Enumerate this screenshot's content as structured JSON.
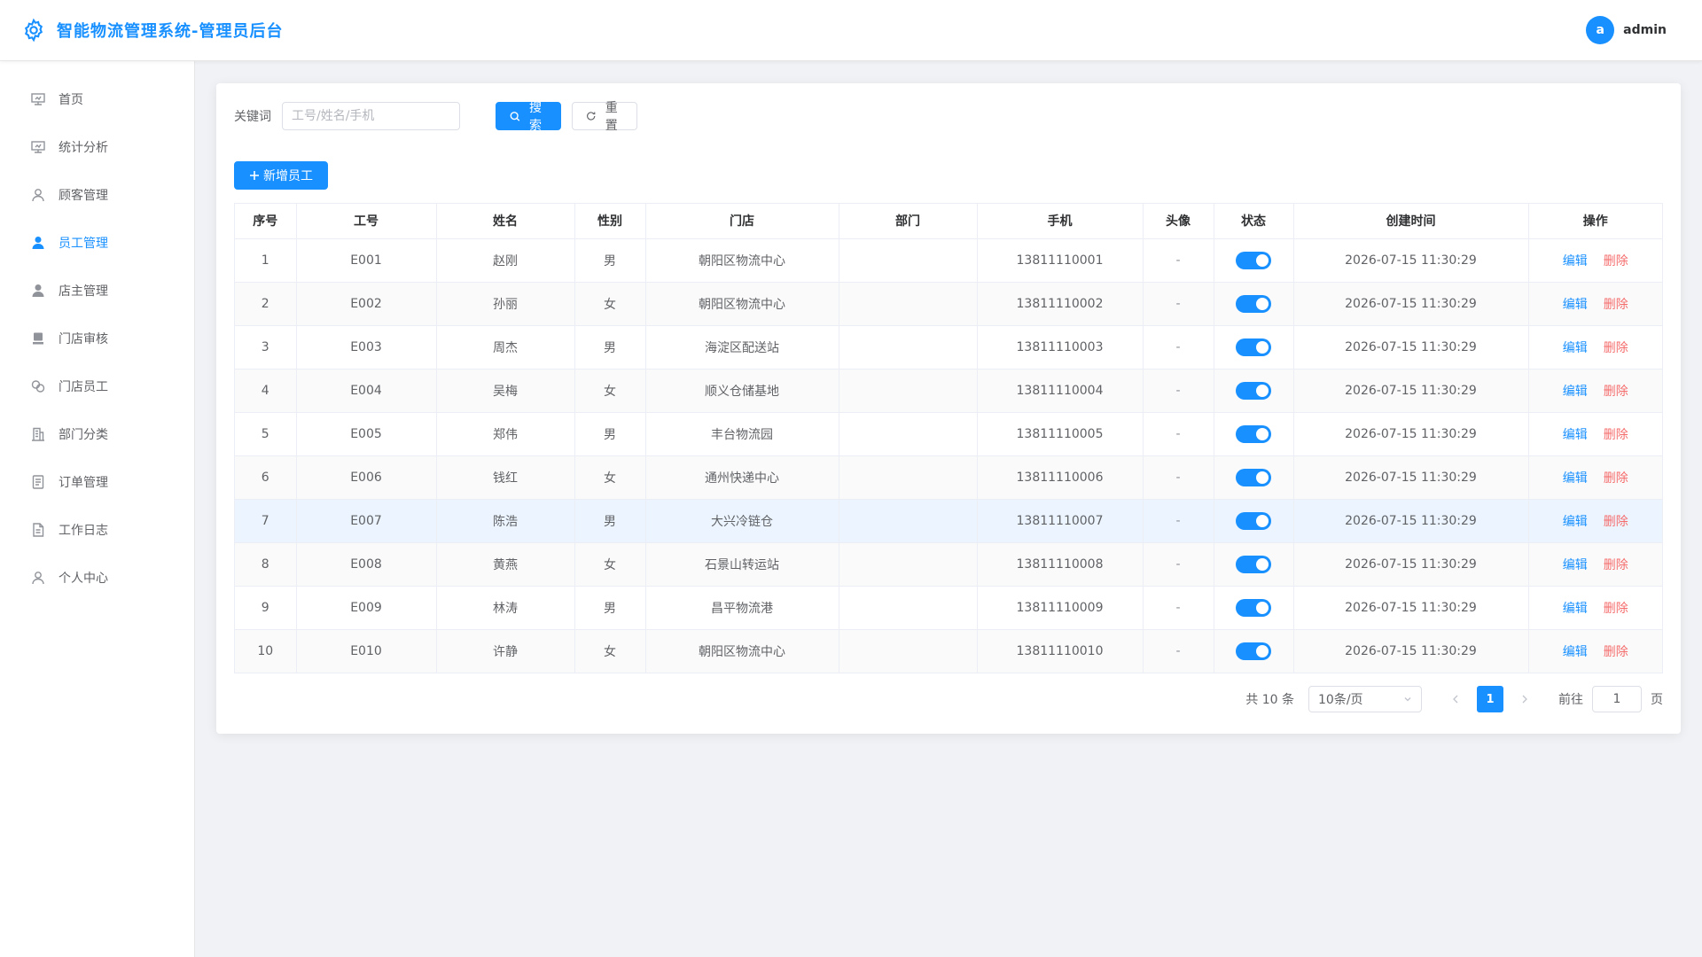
{
  "header": {
    "title": "智能物流管理系统-管理员后台",
    "avatar_letter": "a",
    "username": "admin",
    "accent": "#1890ff"
  },
  "sidebar": {
    "items": [
      {
        "label": "首页",
        "icon": "monitor-icon",
        "active": false
      },
      {
        "label": "统计分析",
        "icon": "monitor-icon",
        "active": false
      },
      {
        "label": "顾客管理",
        "icon": "user-icon",
        "active": false
      },
      {
        "label": "员工管理",
        "icon": "user-filled-icon",
        "active": true
      },
      {
        "label": "店主管理",
        "icon": "user-filled-icon",
        "active": false
      },
      {
        "label": "门店审核",
        "icon": "stamp-icon",
        "active": false
      },
      {
        "label": "门店员工",
        "icon": "connection-icon",
        "active": false
      },
      {
        "label": "部门分类",
        "icon": "office-building-icon",
        "active": false
      },
      {
        "label": "订单管理",
        "icon": "tickets-icon",
        "active": false
      },
      {
        "label": "工作日志",
        "icon": "document-icon",
        "active": false
      },
      {
        "label": "个人中心",
        "icon": "user-icon",
        "active": false
      }
    ]
  },
  "search": {
    "label": "关键词",
    "placeholder": "工号/姓名/手机",
    "value": "",
    "search_btn": "搜索",
    "reset_btn": "重置"
  },
  "toolbar": {
    "add_btn": "新增员工"
  },
  "table": {
    "columns": [
      "序号",
      "工号",
      "姓名",
      "性别",
      "门店",
      "部门",
      "手机",
      "头像",
      "状态",
      "创建时间",
      "操作"
    ],
    "edit_label": "编辑",
    "delete_label": "删除",
    "rows": [
      {
        "no": "1",
        "code": "E001",
        "name": "赵刚",
        "gender": "男",
        "store": "朝阳区物流中心",
        "dept": "",
        "phone": "13811110001",
        "avatar": "-",
        "enabled": true,
        "created": "2026-07-15 11:30:29"
      },
      {
        "no": "2",
        "code": "E002",
        "name": "孙丽",
        "gender": "女",
        "store": "朝阳区物流中心",
        "dept": "",
        "phone": "13811110002",
        "avatar": "-",
        "enabled": true,
        "created": "2026-07-15 11:30:29"
      },
      {
        "no": "3",
        "code": "E003",
        "name": "周杰",
        "gender": "男",
        "store": "海淀区配送站",
        "dept": "",
        "phone": "13811110003",
        "avatar": "-",
        "enabled": true,
        "created": "2026-07-15 11:30:29"
      },
      {
        "no": "4",
        "code": "E004",
        "name": "吴梅",
        "gender": "女",
        "store": "顺义仓储基地",
        "dept": "",
        "phone": "13811110004",
        "avatar": "-",
        "enabled": true,
        "created": "2026-07-15 11:30:29"
      },
      {
        "no": "5",
        "code": "E005",
        "name": "郑伟",
        "gender": "男",
        "store": "丰台物流园",
        "dept": "",
        "phone": "13811110005",
        "avatar": "-",
        "enabled": true,
        "created": "2026-07-15 11:30:29"
      },
      {
        "no": "6",
        "code": "E006",
        "name": "钱红",
        "gender": "女",
        "store": "通州快递中心",
        "dept": "",
        "phone": "13811110006",
        "avatar": "-",
        "enabled": true,
        "created": "2026-07-15 11:30:29"
      },
      {
        "no": "7",
        "code": "E007",
        "name": "陈浩",
        "gender": "男",
        "store": "大兴冷链仓",
        "dept": "",
        "phone": "13811110007",
        "avatar": "-",
        "enabled": true,
        "created": "2026-07-15 11:30:29"
      },
      {
        "no": "8",
        "code": "E008",
        "name": "黄燕",
        "gender": "女",
        "store": "石景山转运站",
        "dept": "",
        "phone": "13811110008",
        "avatar": "-",
        "enabled": true,
        "created": "2026-07-15 11:30:29"
      },
      {
        "no": "9",
        "code": "E009",
        "name": "林涛",
        "gender": "男",
        "store": "昌平物流港",
        "dept": "",
        "phone": "13811110009",
        "avatar": "-",
        "enabled": true,
        "created": "2026-07-15 11:30:29"
      },
      {
        "no": "10",
        "code": "E010",
        "name": "许静",
        "gender": "女",
        "store": "朝阳区物流中心",
        "dept": "",
        "phone": "13811110010",
        "avatar": "-",
        "enabled": true,
        "created": "2026-07-15 11:30:29"
      }
    ]
  },
  "pagination": {
    "total_text": "共 10 条",
    "page_size": "10条/页",
    "current_page": "1",
    "goto_label": "前往",
    "goto_value": "1",
    "page_suffix": "页"
  }
}
